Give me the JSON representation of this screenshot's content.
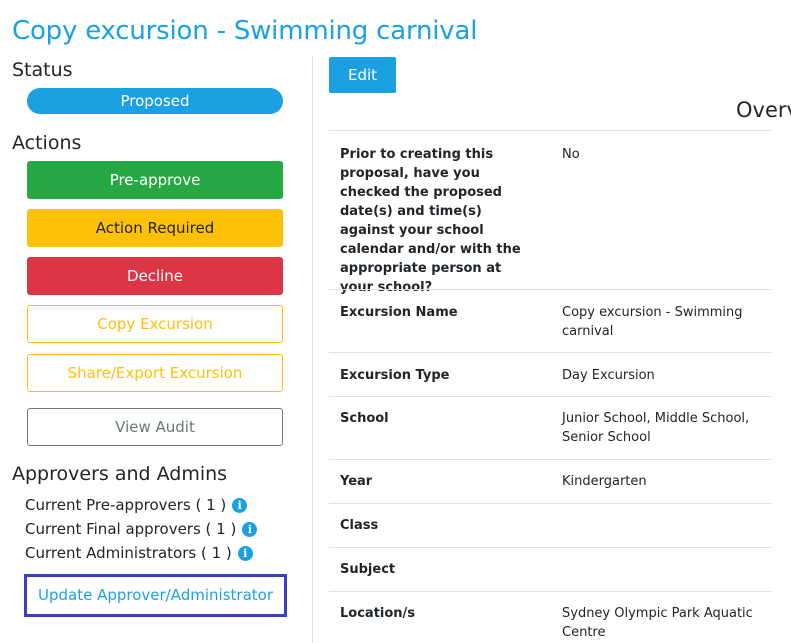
{
  "page": {
    "title": "Copy excursion - Swimming carnival"
  },
  "status": {
    "heading": "Status",
    "value": "Proposed",
    "color": "#1ba1e2"
  },
  "actions": {
    "heading": "Actions",
    "pre_approve": "Pre-approve",
    "action_required": "Action Required",
    "decline": "Decline",
    "copy_excursion": "Copy Excursion",
    "share_export": "Share/Export Excursion",
    "view_audit": "View Audit"
  },
  "approvers": {
    "heading": "Approvers and Admins",
    "pre_approvers": "Current Pre-approvers ( 1 )",
    "final_approvers": "Current Final approvers ( 1 )",
    "administrators": "Current Administrators ( 1 )",
    "update_link": "Update Approver/Administrator",
    "info_icon": "info-circle-icon"
  },
  "main": {
    "edit_label": "Edit",
    "overview_title": "Overv",
    "rows": [
      {
        "label": "Prior to creating this proposal, have you checked the proposed date(s) and time(s) against your school calendar and/or with the appropriate person at your school?",
        "value": "No"
      },
      {
        "label": "Excursion Name",
        "value": "Copy excursion - Swimming carnival"
      },
      {
        "label": "Excursion Type",
        "value": "Day Excursion"
      },
      {
        "label": "School",
        "value": "Junior School, Middle School, Senior School"
      },
      {
        "label": "Year",
        "value": "Kindergarten"
      },
      {
        "label": "Class",
        "value": ""
      },
      {
        "label": "Subject",
        "value": ""
      },
      {
        "label": "Location/s",
        "value": "Sydney Olympic Park Aquatic Centre"
      }
    ]
  },
  "colors": {
    "primary": "#1ba1e2",
    "success": "#28a745",
    "warning": "#ffc107",
    "danger": "#dc3545",
    "secondary": "#6c757d",
    "focus_outline": "#3b3fc4"
  }
}
